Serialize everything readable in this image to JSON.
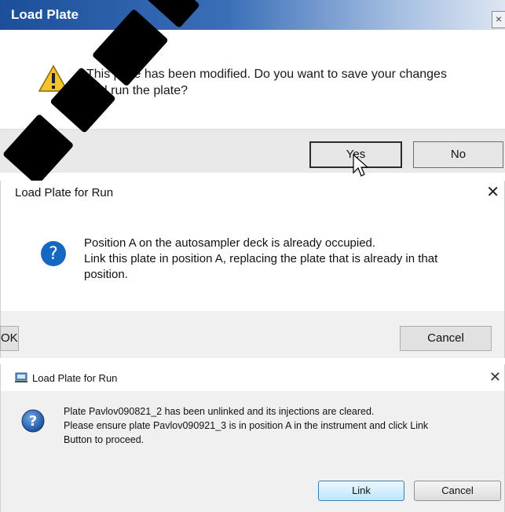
{
  "dialog1": {
    "title": "Load Plate",
    "close_glyph": "×",
    "message_line1": "This plate has been modified. Do you want to save your changes",
    "message_line2": "and run the plate?",
    "icon": "warning-icon",
    "yes_label": "Yes",
    "no_label": "No"
  },
  "dialog2": {
    "title": "Load Plate for Run",
    "close_glyph": "✕",
    "message_line1": "Position A on the autosampler deck is already occupied.",
    "message_line2": "Link this plate in position A, replacing the plate that is already in that",
    "message_line3": "position.",
    "icon": "question-icon",
    "ok_label": "OK",
    "cancel_label": "Cancel"
  },
  "dialog3": {
    "title": "Load Plate for Run",
    "close_glyph": "✕",
    "message_line1": "Plate Pavlov090821_2 has been unlinked and its injections are cleared.",
    "message_line2": "Please ensure plate Pavlov090921_3 is in position A in the instrument and click Link",
    "message_line3": "Button to proceed.",
    "icon": "question-icon",
    "link_label": "Link",
    "cancel_label": "Cancel"
  },
  "colors": {
    "title_gradient_start": "#1c4f9a",
    "question_blue": "#1467c2",
    "focus_blue": "#0078d7",
    "watermark": "#000000"
  }
}
